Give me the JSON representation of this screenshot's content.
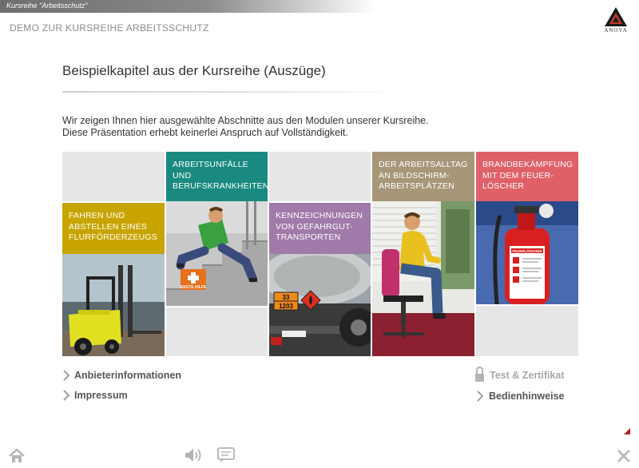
{
  "header": {
    "course_title": "Kursreihe \"Arbeitsschutz\"",
    "subtitle": "DEMO ZUR KURSREIHE ARBEITSSCHUTZ",
    "logo_text": "ANOVA"
  },
  "main": {
    "heading": "Beispielkapitel aus der Kursreihe (Auszüge)",
    "intro_line1": "Wir zeigen Ihnen hier ausgewählte Abschnitte aus den Modulen unserer Kursreihe.",
    "intro_line2": "Diese Präsentation erhebt keinerlei Anspruch auf Vollständigkeit."
  },
  "tiles": [
    {
      "label": "FAHREN UND ABSTELLEN EINES FLURFÖRDERZEUGS",
      "color": "#c8a400"
    },
    {
      "label": "ARBEITSUNFÄLLE UND BERUFSKRANKHEITEN",
      "color": "#1a8a80"
    },
    {
      "label": "KENNZEICHNUNGEN VON GEFAHRGUT-TRANSPORTEN",
      "color": "#a07aa8"
    },
    {
      "label": "DER ARBEITSALLTAG AN BILDSCHIRM-ARBEITSPLÄTZEN",
      "color": "#a89678"
    },
    {
      "label": "BRANDBEKÄMPFUNG MIT DEM FEUER-LÖSCHER",
      "color": "#e06068"
    }
  ],
  "image_text": {
    "first_aid": "ERSTE HILFE",
    "hazard_top": "33",
    "hazard_bottom": "1203",
    "extinguisher": "FEUERLÖSCHER"
  },
  "footer_links": {
    "provider": "Anbieterinformationen",
    "imprint": "Impressum",
    "test": "Test & Zertifikat",
    "help": "Bedienhinweise"
  },
  "icons": [
    "home-icon",
    "speaker-icon",
    "notes-icon",
    "close-icon",
    "lock-icon",
    "chevron-right-icon"
  ]
}
